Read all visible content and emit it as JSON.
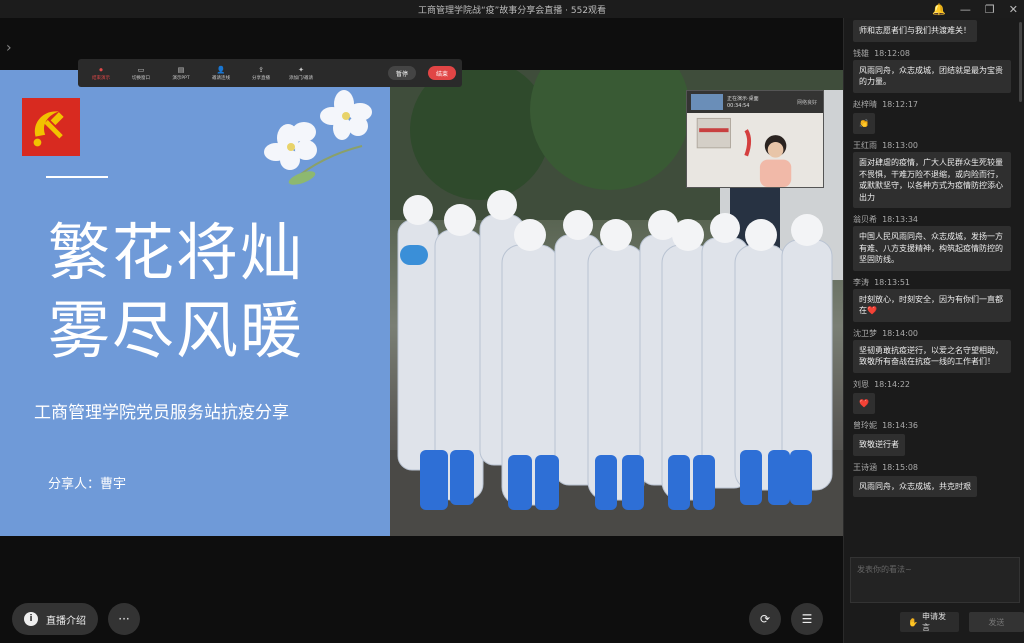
{
  "window": {
    "title": "工商管理学院战“疫”故事分享会直播 · 552观看"
  },
  "toolbar": {
    "items": [
      "结束演示",
      "切换窗口",
      "演示PPT",
      "邀请连线",
      "分享直播",
      "添加门/邀请"
    ],
    "pause_label": "暂停",
    "end_label": "结束"
  },
  "slide": {
    "title_line1": "繁花将灿",
    "title_line2": "雾尽风暖",
    "subtitle": "工商管理学院党员服务站抗疫分享",
    "presenter": "分享人：曹宇"
  },
  "camera": {
    "status": "正在演示·桌面",
    "time": "00:34:54",
    "network": "网络良好"
  },
  "bottom": {
    "intro_label": "直播介绍",
    "more_label": "···"
  },
  "chat": {
    "messages": [
      {
        "user": "",
        "time": "",
        "text": "师和志愿者们与我们共渡难关！"
      },
      {
        "user": "钱雄",
        "time": "18:12:08",
        "text": "风雨同舟，众志成城，团结就是最为宝贵的力量。"
      },
      {
        "user": "赵梓晴",
        "time": "18:12:17",
        "text": "👏"
      },
      {
        "user": "王红雨",
        "time": "18:13:00",
        "text": "面对肆虐的疫情，广大人民群众生死较量不畏惧，干难万险不退缩，或向险而行，或默默坚守，以各种方式为疫情防控添心出力"
      },
      {
        "user": "翁贝希",
        "time": "18:13:34",
        "text": "中国人民风雨同舟、众志成城，发扬一方有难、八方支援精神，构筑起疫情防控的坚固防线。"
      },
      {
        "user": "李涛",
        "time": "18:13:51",
        "text": "时刻放心，时刻安全，因为有你们一直都在❤️"
      },
      {
        "user": "沈卫梦",
        "time": "18:14:00",
        "text": "坚韧勇敢抗疫逆行，以爱之名守望相助，致敬所有奋战在抗疫一线的工作者们！"
      },
      {
        "user": "刘恩",
        "time": "18:14:22",
        "text": "❤️"
      },
      {
        "user": "曾玲妮",
        "time": "18:14:36",
        "text": "致敬逆行者"
      },
      {
        "user": "王诗涵",
        "time": "18:15:08",
        "text": "风雨同舟，众志成城，共克时艰"
      }
    ],
    "input_placeholder": "发表你的看法~",
    "raise_hand_label": "申请发言",
    "send_label": "发送"
  }
}
